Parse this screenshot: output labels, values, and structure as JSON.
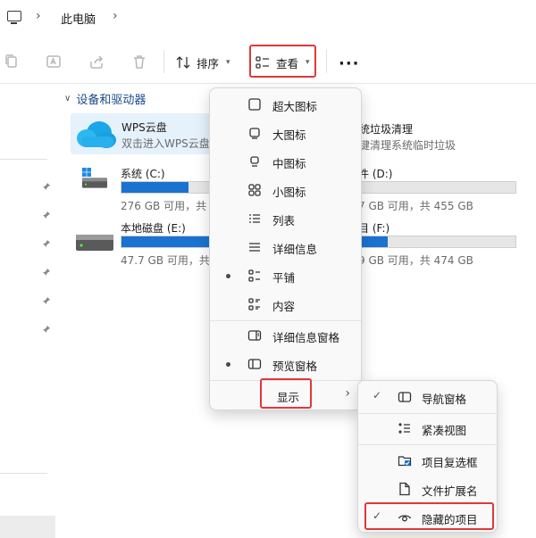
{
  "address_bar": {
    "crumb": "此电脑"
  },
  "toolbar": {
    "icons": [
      "copy-icon",
      "rename-icon",
      "share-icon",
      "delete-icon"
    ],
    "sort_label": "排序",
    "view_label": "查看",
    "more_label": "···",
    "highlight_color": "#e0383a"
  },
  "content": {
    "section_title": "设备和驱动器",
    "wps": {
      "name": "WPS云盘",
      "subtitle": "双击进入WPS云盘"
    },
    "cleaner": {
      "name": "统垃圾清理",
      "subtitle": "键清理系统临时垃圾"
    },
    "drives": [
      {
        "name": "系统 (C:)",
        "sub": "276 GB 可用，共",
        "fill": 0.27
      },
      {
        "name": "件 (D:)",
        "sub": "7 GB 可用，共 455 GB",
        "fill": 0.0
      },
      {
        "name": "本地磁盘 (E:)",
        "sub": "47.7 GB 可用，共",
        "fill": 0.9
      },
      {
        "name": "目 (F:)",
        "sub": "9 GB 可用，共 474 GB",
        "fill": 0.2
      }
    ],
    "accent_color": "#1a73d0"
  },
  "view_menu": {
    "items": [
      {
        "label": "超大图标",
        "icon": "extra-large-icons-icon"
      },
      {
        "label": "大图标",
        "icon": "large-icons-icon"
      },
      {
        "label": "中图标",
        "icon": "medium-icons-icon"
      },
      {
        "label": "小图标",
        "icon": "small-icons-icon"
      },
      {
        "label": "列表",
        "icon": "list-icon"
      },
      {
        "label": "详细信息",
        "icon": "details-icon"
      },
      {
        "label": "平铺",
        "icon": "tiles-icon",
        "selected": true
      },
      {
        "label": "内容",
        "icon": "content-icon"
      },
      {
        "label": "详细信息窗格",
        "icon": "details-pane-icon"
      },
      {
        "label": "预览窗格",
        "icon": "preview-pane-icon",
        "selected": true
      },
      {
        "label": "显示",
        "icon": "",
        "submenu_arrow": "›"
      }
    ]
  },
  "show_menu": {
    "items": [
      {
        "label": "导航窗格",
        "icon": "navigation-pane-icon",
        "checked": true,
        "check": "✓"
      },
      {
        "label": "紧凑视图",
        "icon": "compact-view-icon",
        "checked": false
      },
      {
        "label": "项目复选框",
        "icon": "item-checkbox-icon",
        "checked": false
      },
      {
        "label": "文件扩展名",
        "icon": "file-extension-icon",
        "checked": false
      },
      {
        "label": "隐藏的项目",
        "icon": "hidden-items-icon",
        "checked": true,
        "check": "✓"
      }
    ]
  }
}
